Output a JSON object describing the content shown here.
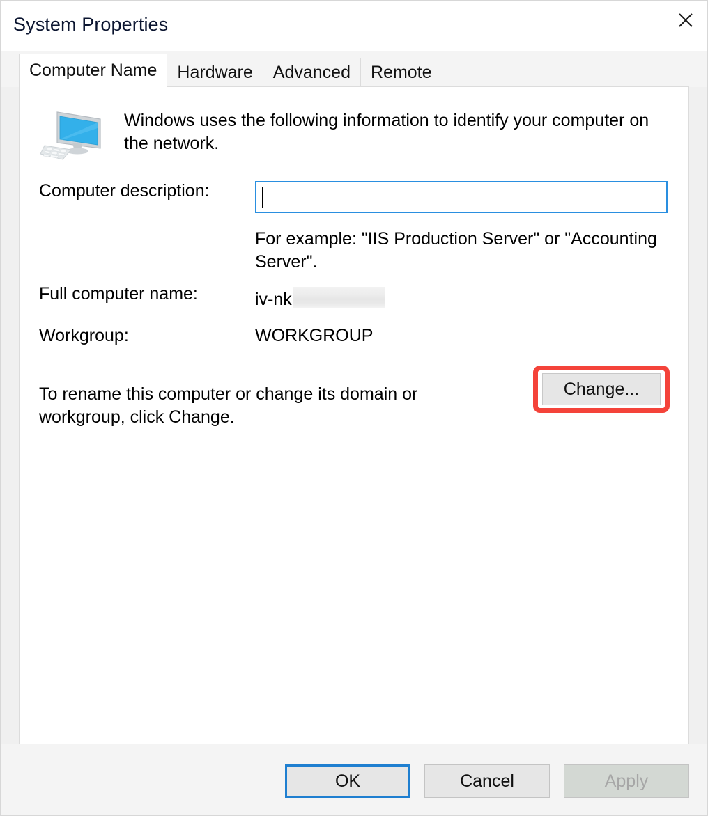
{
  "window": {
    "title": "System Properties",
    "close_icon": "close-icon"
  },
  "tabs": [
    {
      "label": "Computer Name",
      "active": true
    },
    {
      "label": "Hardware",
      "active": false
    },
    {
      "label": "Advanced",
      "active": false
    },
    {
      "label": "Remote",
      "active": false
    }
  ],
  "intro": {
    "icon": "computer-monitor-icon",
    "text": "Windows uses the following information to identify your computer on the network."
  },
  "fields": {
    "description_label": "Computer description:",
    "description_value": "",
    "description_placeholder": "",
    "example_text": "For example: \"IIS Production Server\" or \"Accounting Server\".",
    "full_name_label": "Full computer name:",
    "full_name_value": "iv-nk",
    "full_name_redacted": true,
    "workgroup_label": "Workgroup:",
    "workgroup_value": "WORKGROUP"
  },
  "rename": {
    "text": "To rename this computer or change its domain or workgroup, click Change.",
    "button_label": "Change...",
    "highlight_color": "#f4433a",
    "highlighted": true
  },
  "footer": {
    "ok_label": "OK",
    "cancel_label": "Cancel",
    "apply_label": "Apply",
    "apply_disabled": true,
    "focus_color": "#1f7fd0"
  },
  "colors": {
    "accent_blue": "#2a8fe0",
    "dialog_bg": "#f0f0f0",
    "panel_bg": "#ffffff",
    "annotation_red": "#f4433a"
  }
}
